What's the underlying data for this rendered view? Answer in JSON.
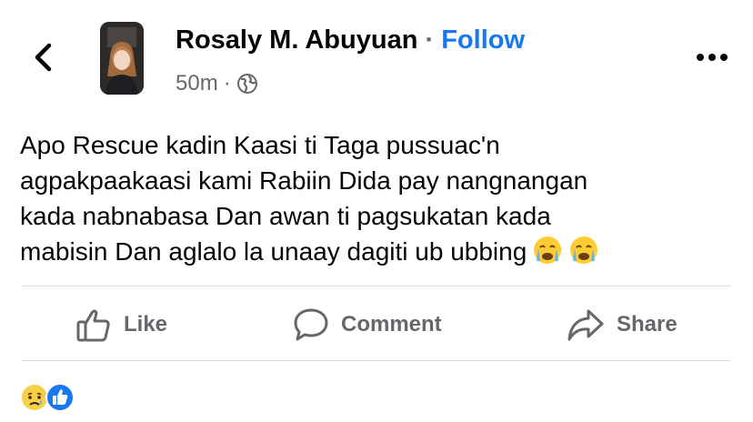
{
  "header": {
    "back_icon": "chevron-left-icon",
    "author_name": "Rosaly M. Abuyuan",
    "separator": "·",
    "follow_label": "Follow",
    "time_ago": "50m",
    "meta_separator": "·",
    "audience_icon": "globe-icon",
    "more_icon": "more-dots-icon"
  },
  "post": {
    "text": "Apo Rescue kadin  Kaasi ti Taga pussuac'n\nagpakpaakaasi kami Rabiin Dida pay nangnangan\nkada nabnabasa Dan awan ti pagsukatan kada\nmabisin Dan aglalo la unaay dagiti ub ubbing",
    "trailing_emojis": [
      "crying-face",
      "crying-face"
    ]
  },
  "actions": [
    {
      "icon": "like-icon",
      "label": "Like"
    },
    {
      "icon": "comment-icon",
      "label": "Comment"
    },
    {
      "icon": "share-icon",
      "label": "Share"
    }
  ],
  "reactions": [
    "sad-reaction",
    "like-reaction"
  ],
  "colors": {
    "accent": "#1877f2",
    "secondary_text": "#65676b",
    "divider": "#dadde1"
  }
}
